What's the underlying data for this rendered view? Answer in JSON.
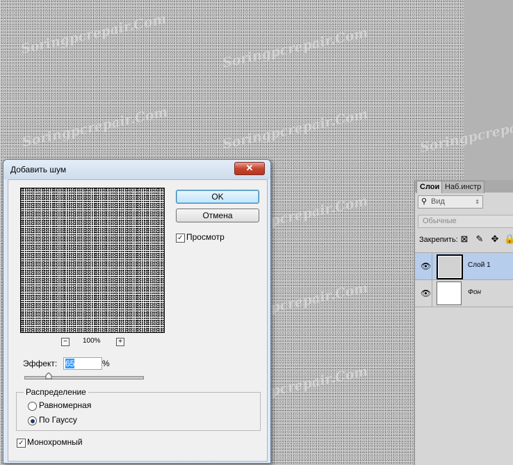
{
  "canvas": {
    "watermark_text": "Soringpcrepair.Com"
  },
  "dialog": {
    "title": "Добавить шум",
    "close_glyph": "✕",
    "ok_label": "OK",
    "cancel_label": "Отмена",
    "preview_label": "Просмотр",
    "preview_checked": true,
    "zoom_out_glyph": "−",
    "zoom_in_glyph": "+",
    "zoom_level": "100%",
    "effect_label": "Эффект:",
    "effect_value": "65",
    "effect_unit": "%",
    "effect_slider_fraction": 0.2,
    "distribution_title": "Распределение",
    "distribution_options": [
      {
        "label": "Равномерная",
        "selected": false
      },
      {
        "label": "По Гауссу",
        "selected": true
      }
    ],
    "monochrome_label": "Монохромный",
    "monochrome_checked": true
  },
  "layers_panel": {
    "tabs": [
      "Слои",
      "Наб.инстр"
    ],
    "filter_label": "Вид",
    "filter_icon": "search-icon",
    "blend_mode": "Обычные",
    "lock_label": "Закрепить:",
    "lock_icons": [
      "lock-transparent-icon",
      "brush-icon",
      "move-icon",
      "lock-icon"
    ],
    "layers": [
      {
        "name": "Слой 1",
        "visible": true,
        "selected": true
      },
      {
        "name": "Фон",
        "visible": true,
        "selected": false
      }
    ]
  },
  "colors": {
    "selection": "#3399ff",
    "selected_layer": "#b6cdec",
    "close_button": "#c7452f"
  }
}
